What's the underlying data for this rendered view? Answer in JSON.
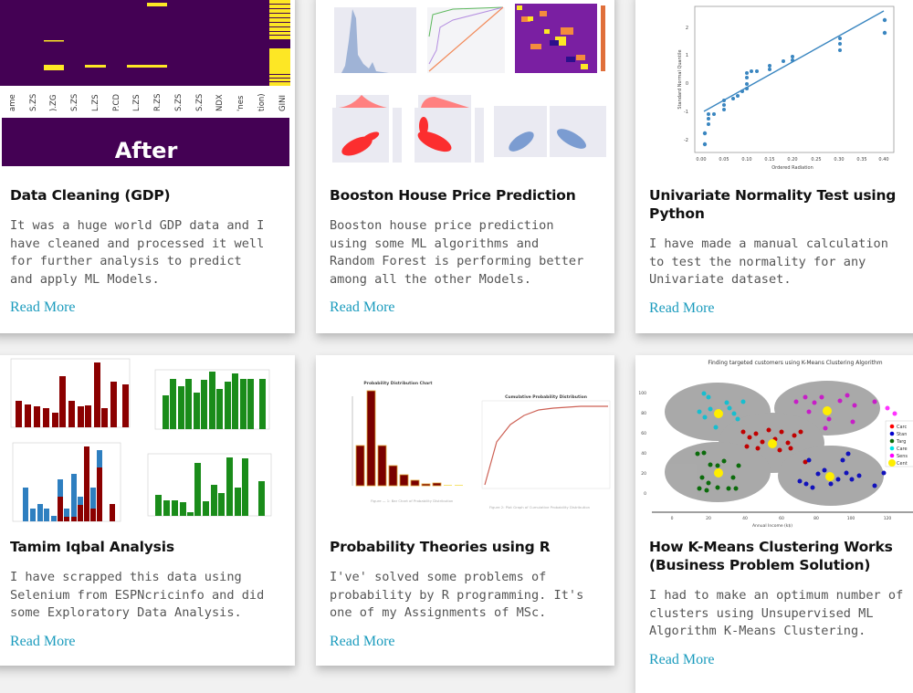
{
  "cards": [
    {
      "title": "Data Cleaning (GDP)",
      "description": "It was a huge world GDP data and I\nhave cleaned and processed it well\nfor further analysis to predict\nand apply ML Models.",
      "link": "Read More",
      "thumbnail": {
        "banner_text": "After",
        "axis_labels": [
          "ame",
          "S.ZS",
          ").ZG",
          "S.ZS",
          "L.ZS",
          "P.CD",
          "L.ZS",
          "R.ZS",
          "S.ZS",
          "S.ZS",
          "NDX",
          "'nes",
          "tion)",
          "GINI"
        ]
      }
    },
    {
      "title": "Booston House Price Prediction",
      "description": "Booston house price prediction\nusing some ML algorithms and\nRandom Forest is performing better\namong all the other Models.",
      "link": "Read More"
    },
    {
      "title": "Univariate Normality Test using Python",
      "description": "I have made a manual calculation\nto test the normality for any\nUnivariate dataset.",
      "link": "Read More",
      "thumbnail": {
        "xlabel": "Ordered Radiation",
        "ylabel": "Standard Normal Quantile",
        "x_ticks": [
          "0.00",
          "0.05",
          "0.10",
          "0.15",
          "0.20",
          "0.25",
          "0.30",
          "0.35",
          "0.40"
        ],
        "y_ticks": [
          "2",
          "1",
          "0",
          "-1",
          "-2"
        ]
      }
    },
    {
      "title": "Tamim Iqbal Analysis",
      "description": "I have scrapped this data using\nSelenium from ESPNcricinfo and did\nsome Exploratory Data Analysis.",
      "link": "Read More"
    },
    {
      "title": "Probability Theories using R",
      "description": "I've' solved some problems of\nprobability by R programming. It's\none of my Assignments of MSc.",
      "link": "Read More",
      "thumbnail": {
        "left_title": "Probability Distribution Chart",
        "right_title": "Cumulative Probability Distribution"
      }
    },
    {
      "title": "How K-Means Clustering Works (Business Problem Solution)",
      "description": "I had to make an optimum number of\nclusters using Unsupervised ML\nAlgorithm K-Means Clustering.",
      "link": "Read More",
      "thumbnail": {
        "title": "Finding targeted customers using K-Means Clustering Algorithm",
        "xlabel": "Annual Income (k$)",
        "x_ticks": [
          "0",
          "20",
          "40",
          "60",
          "80",
          "100",
          "120"
        ],
        "y_ticks": [
          "100",
          "80",
          "60",
          "40",
          "20",
          "0"
        ],
        "legend": [
          "Carc",
          "Stan",
          "Targ",
          "Care",
          "Sens",
          "Cent"
        ]
      }
    }
  ]
}
